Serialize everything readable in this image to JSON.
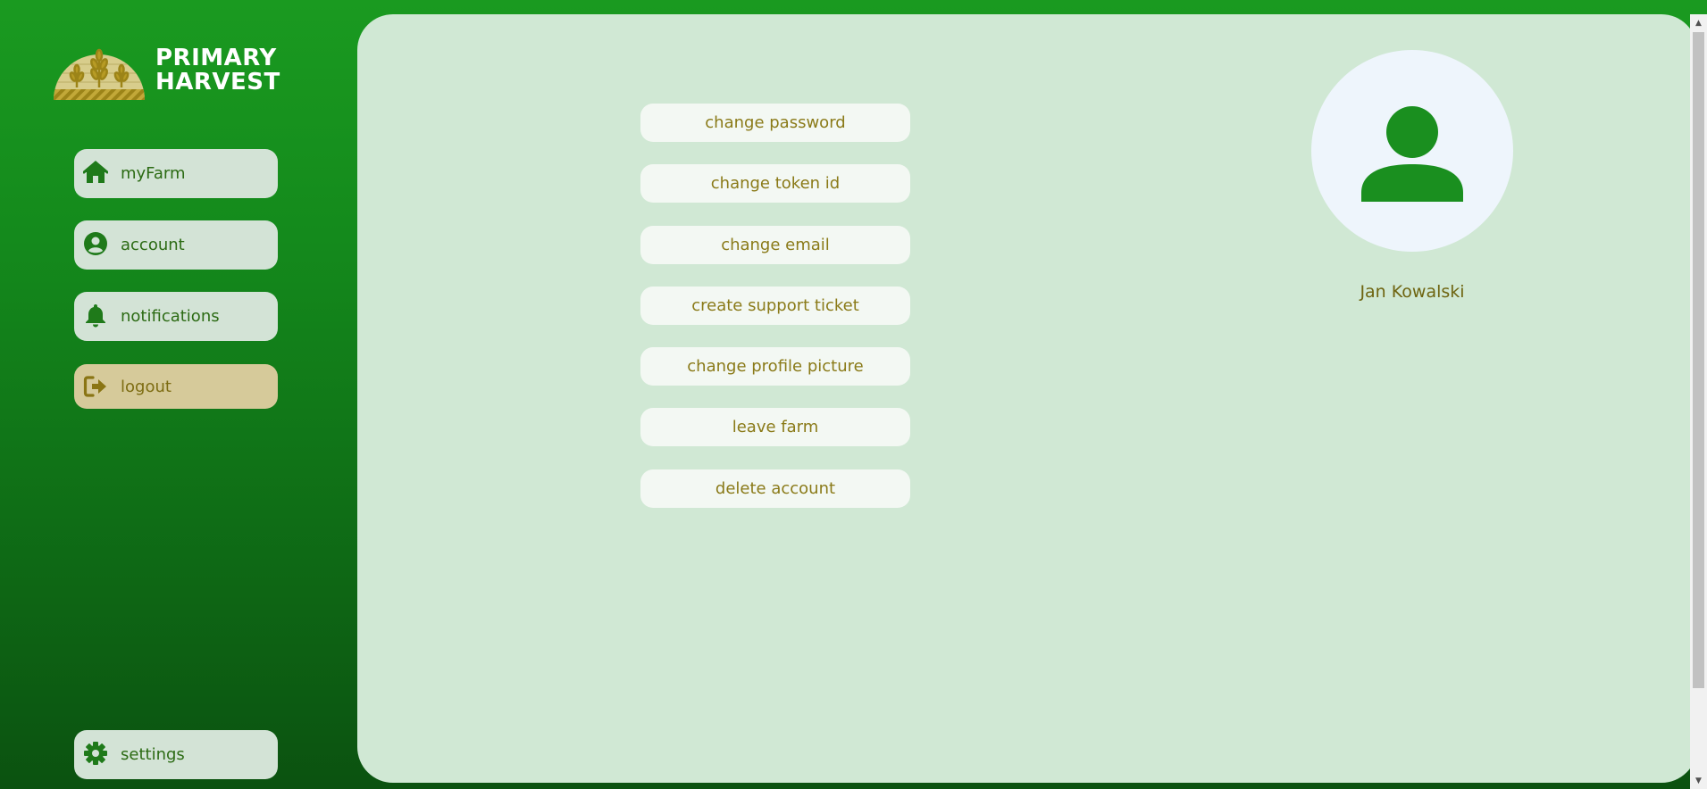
{
  "brand": {
    "line1": "PRIMARY",
    "line2": "HARVEST",
    "emblem_icon": "wheat-field-emblem-icon"
  },
  "sidebar": {
    "items": [
      {
        "label": "myFarm",
        "icon": "home-icon"
      },
      {
        "label": "account",
        "icon": "user-circle-icon"
      },
      {
        "label": "notifications",
        "icon": "bell-icon"
      },
      {
        "label": "logout",
        "icon": "logout-icon"
      }
    ],
    "settings": {
      "label": "settings",
      "icon": "gear-icon"
    }
  },
  "actions": [
    "change password",
    "change token id",
    "change email",
    "create support ticket",
    "change profile picture",
    "leave farm",
    "delete account"
  ],
  "profile": {
    "name": "Jan Kowalski",
    "avatar_icon": "user-avatar-icon"
  },
  "colors": {
    "sidebar_gradient_top": "#1a9a20",
    "sidebar_gradient_bottom": "#0b5210",
    "panel_bg": "#d0e8d4",
    "button_bg": "#f3f8f3",
    "button_text": "#8a7a18",
    "nav_bg": "#d3e3d6",
    "nav_text": "#2c6b14",
    "logout_bg": "#d6ca9a",
    "avatar_fill": "#1a8f1f"
  }
}
